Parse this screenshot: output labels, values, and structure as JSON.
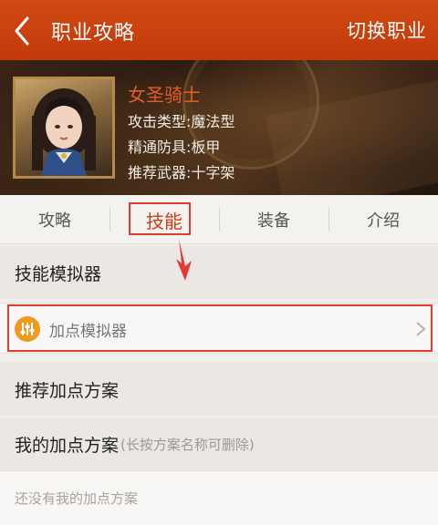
{
  "header": {
    "title": "职业攻略",
    "switch_label": "切换职业"
  },
  "hero": {
    "name": "女圣骑士",
    "attack_type": "攻击类型:魔法型",
    "armor": "精通防具:板甲",
    "weapon": "推荐武器:十字架"
  },
  "tabs": [
    {
      "label": "攻略"
    },
    {
      "label": "技能"
    },
    {
      "label": "装备"
    },
    {
      "label": "介绍"
    }
  ],
  "active_tab": "技能",
  "sections": {
    "simulator_title": "技能模拟器",
    "simulator_item": "加点模拟器",
    "recommended_title": "推荐加点方案",
    "my_plans_title": "我的加点方案",
    "my_plans_hint": "(长按方案名称可删除)",
    "empty_text": "还没有我的加点方案"
  },
  "colors": {
    "brand": "#c93f0c",
    "active_tab": "#d13b12",
    "annotation": "#e53935",
    "simulator_icon": "#ee9a1e"
  }
}
